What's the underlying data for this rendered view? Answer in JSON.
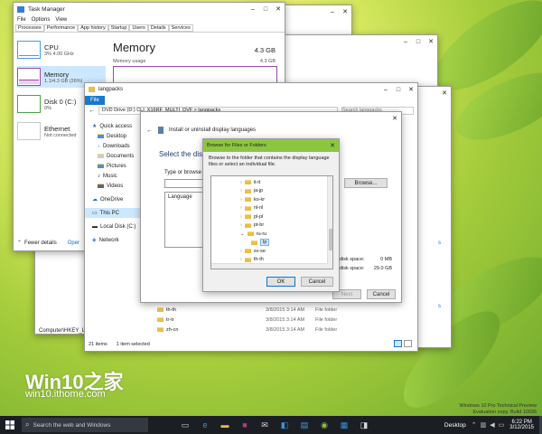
{
  "task_manager": {
    "title": "Task Manager",
    "menu": [
      "File",
      "Options",
      "View"
    ],
    "tabs": [
      "Processes",
      "Performance",
      "App history",
      "Startup",
      "Users",
      "Details",
      "Services"
    ],
    "active_tab": "Performance",
    "sidebar": [
      {
        "name": "CPU",
        "detail": "3% 4.00 GHz"
      },
      {
        "name": "Memory",
        "detail": "1.1/4.3 GB (26%)"
      },
      {
        "name": "Disk 0 (C:)",
        "detail": "0%"
      },
      {
        "name": "Ethernet",
        "detail": "Not connected"
      }
    ],
    "heading": "Memory",
    "total": "4.3 GB",
    "usage_label": "Memory usage",
    "usage_max": "4.3 GB",
    "fewer_details": "Fewer details",
    "open_monitor": "Oper"
  },
  "regedit": {
    "path": "Computer\\HKEY_LO"
  },
  "explorer": {
    "title": "langpacks",
    "ribbon_file": "File",
    "address": "DVD Drive (D:) CLI_X16RF_MULTI_DVF > langpacks",
    "search_placeholder": "Search langpacks",
    "nav": [
      {
        "label": "Quick access",
        "icon": "star-icon"
      },
      {
        "label": "Desktop",
        "icon": "desktop-icon"
      },
      {
        "label": "Downloads",
        "icon": "downloads-icon"
      },
      {
        "label": "Documents",
        "icon": "documents-icon"
      },
      {
        "label": "Pictures",
        "icon": "pictures-icon"
      },
      {
        "label": "Music",
        "icon": "music-icon"
      },
      {
        "label": "Videos",
        "icon": "videos-icon"
      },
      {
        "label": "OneDrive",
        "icon": "cloud-icon"
      },
      {
        "label": "This PC",
        "icon": "computer-icon"
      },
      {
        "label": "Local Disk (C:)",
        "icon": "drive-icon"
      },
      {
        "label": "Network",
        "icon": "network-icon"
      }
    ],
    "rows": [
      {
        "name": "th-th",
        "date": "3/8/2015 3:14 AM",
        "type": "File folder"
      },
      {
        "name": "tr-tr",
        "date": "3/8/2015 3:14 AM",
        "type": "File folder"
      },
      {
        "name": "zh-cn",
        "date": "3/8/2015 3:14 AM",
        "type": "File folder"
      }
    ],
    "items_count": "21 items",
    "selected": "1 item selected"
  },
  "lang_wizard": {
    "title": "Install or uninstall display languages",
    "heading": "Select the displ",
    "type_browse": "Type or browse to",
    "language_header": "Language",
    "browse": "Browse...",
    "disk_space_1": "disk space:",
    "disk_value_1": "0 MB",
    "disk_space_2": "disk space:",
    "disk_value_2": "29.0 GB",
    "next": "Next",
    "cancel": "Cancel"
  },
  "browse_dialog": {
    "title": "Browse for Files or Folders",
    "description": "Browse to the folder that contains the display language files or select an individual file.",
    "tree": [
      "it-it",
      "ja-jp",
      "ko-kr",
      "nl-nl",
      "pl-pl",
      "pt-br",
      "ru-ru",
      "lp",
      "sv-se",
      "th-th"
    ],
    "expanded": "ru-ru",
    "selected": "lp",
    "ok": "OK",
    "cancel": "Cancel"
  },
  "right_window": {
    "link1": "s",
    "link2": "s"
  },
  "watermark": {
    "logo": "Win10之家",
    "url": "win10.ithome.com"
  },
  "build_info": {
    "line1": "Windows 10 Pro Technical Preview",
    "line2": "Evaluation copy. Build 10036"
  },
  "taskbar": {
    "search_placeholder": "Search the web and Windows",
    "desktop_label": "Desktop",
    "time": "6:22 PM",
    "date": "3/12/2015"
  },
  "colors": {
    "accent": "#0078d7",
    "memory_purple": "#9b4bab",
    "dialog_green": "#8cc63f",
    "taskbar": "#1b1f24"
  }
}
